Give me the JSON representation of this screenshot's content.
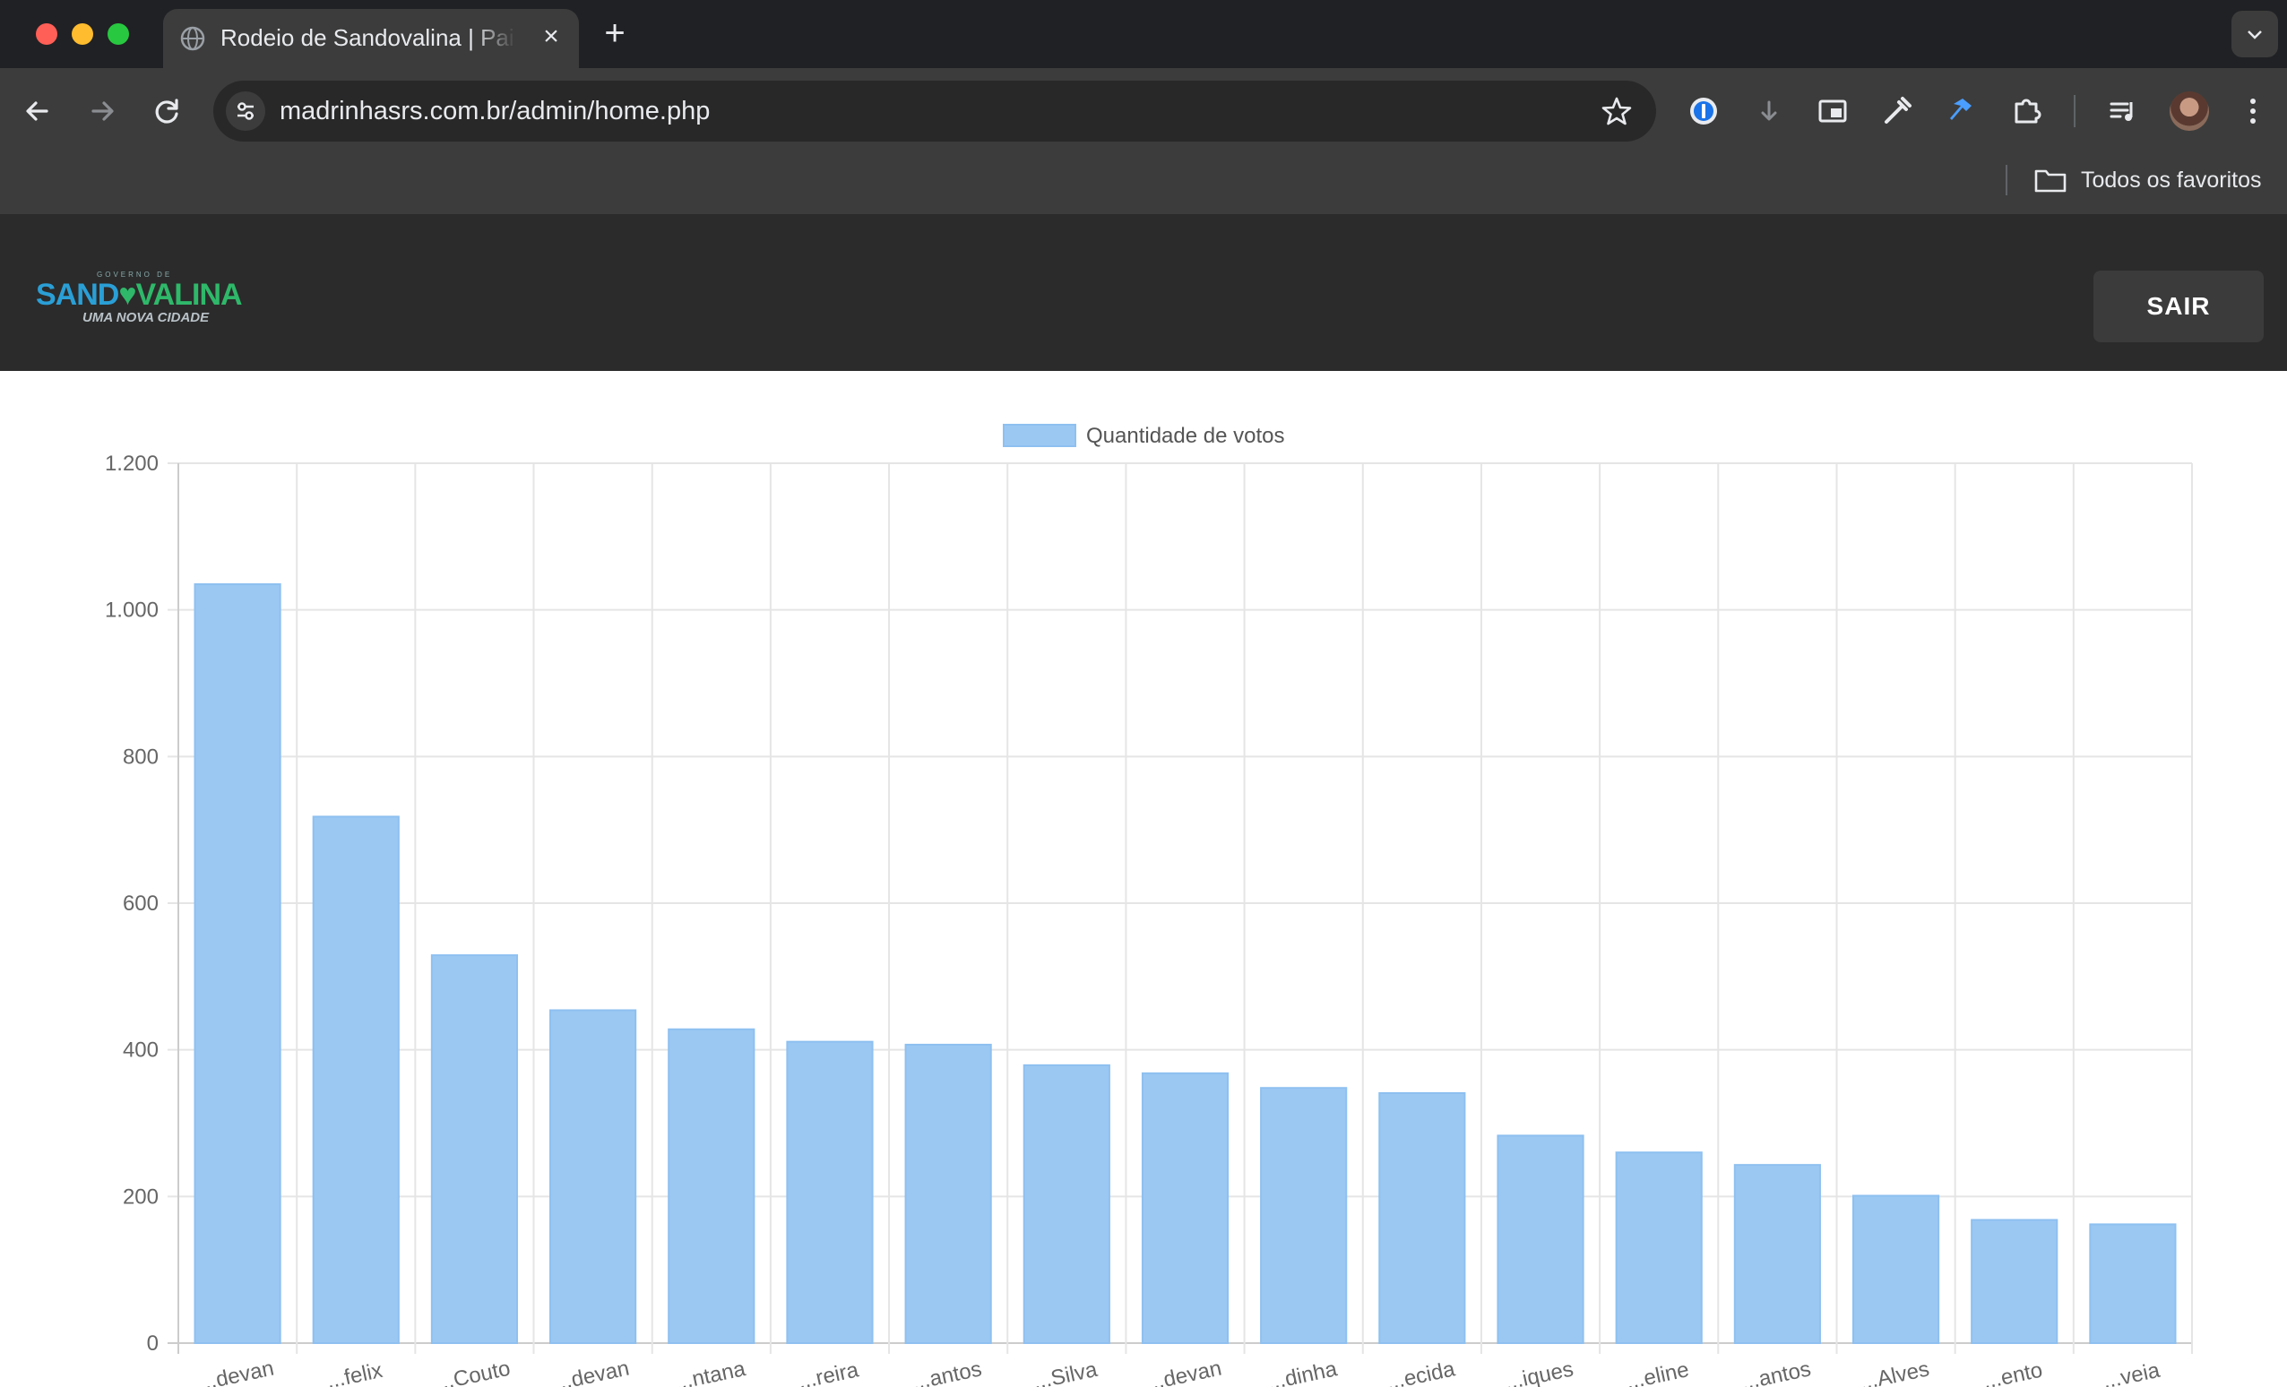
{
  "browser": {
    "tab_title": "Rodeio de Sandovalina | Painel",
    "tab_close": "×",
    "new_tab": "+",
    "url": "madrinhasrs.com.br/admin/home.php",
    "bookmarks_all": "Todos os favoritos"
  },
  "header": {
    "logo_top": "GOVERNO DE",
    "logo_main_a": "SAND",
    "logo_main_b": "VALINA",
    "logo_sub": "UMA NOVA CIDADE",
    "logout_label": "SAIR"
  },
  "colors": {
    "bar_fill": "#9bc8f3",
    "bar_stroke": "#8ec0f0",
    "grid": "#e5e5e5",
    "axis": "#cccccc"
  },
  "chart_data": {
    "type": "bar",
    "legend": [
      "Quantidade de votos"
    ],
    "legend_position": "top",
    "grid": true,
    "ylim": [
      0,
      1200
    ],
    "yticks": [
      "0",
      "200",
      "400",
      "600",
      "800",
      "1.000",
      "1.200"
    ],
    "ytick_values": [
      0,
      200,
      400,
      600,
      800,
      1000,
      1200
    ],
    "categories": [
      "...devan",
      "...felix",
      "...Couto",
      "...devan",
      "...ntana",
      "...reira",
      "...antos",
      "...Silva",
      "...devan",
      "...dinha",
      "...ecida",
      "...iques",
      "...eline",
      "...antos",
      "...Alves",
      "...ento",
      "...veia"
    ],
    "series": [
      {
        "name": "Quantidade de votos",
        "values": [
          1035,
          718,
          529,
          454,
          428,
          411,
          407,
          379,
          368,
          348,
          341,
          283,
          260,
          243,
          201,
          168,
          162
        ]
      }
    ]
  }
}
